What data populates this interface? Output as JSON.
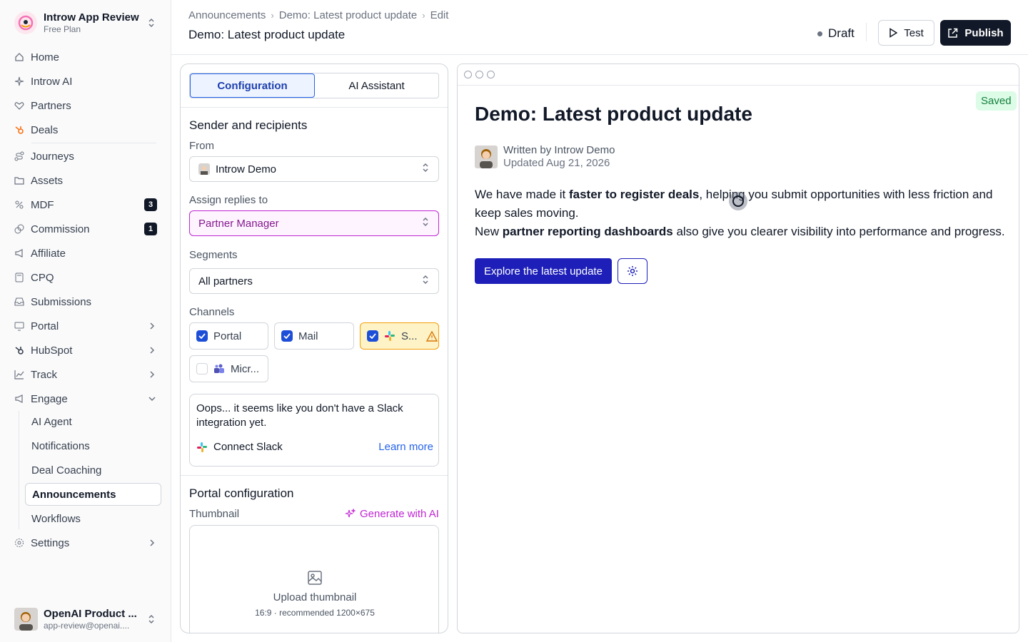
{
  "workspace": {
    "name": "Introw App Review",
    "plan": "Free Plan"
  },
  "nav": {
    "home": "Home",
    "introw_ai": "Introw AI",
    "partners": "Partners",
    "deals": "Deals",
    "journeys": "Journeys",
    "assets": "Assets",
    "mdf": "MDF",
    "mdf_count": "3",
    "commission": "Commission",
    "commission_count": "1",
    "affiliate": "Affiliate",
    "cpq": "CPQ",
    "submissions": "Submissions",
    "portal": "Portal",
    "hubspot": "HubSpot",
    "track": "Track",
    "engage": "Engage",
    "engage_items": [
      "AI Agent",
      "Notifications",
      "Deal Coaching",
      "Announcements",
      "Workflows"
    ],
    "settings": "Settings"
  },
  "user": {
    "name": "OpenAI Product ...",
    "email": "app-review@openai...."
  },
  "header": {
    "breadcrumbs": [
      "Announcements",
      "Demo: Latest product update",
      "Edit"
    ],
    "title": "Demo: Latest product update",
    "status": "Draft",
    "test_label": "Test",
    "publish_label": "Publish"
  },
  "config": {
    "tabs": [
      "Configuration",
      "AI Assistant"
    ],
    "section_title": "Sender and recipients",
    "from_label": "From",
    "from_value": "Introw Demo",
    "replies_label": "Assign replies to",
    "replies_value": "Partner Manager",
    "segments_label": "Segments",
    "segments_value": "All partners",
    "channels_label": "Channels",
    "channels": [
      {
        "label": "Portal",
        "checked": true
      },
      {
        "label": "Mail",
        "checked": true
      },
      {
        "label": "S...",
        "checked": true,
        "warning": true
      },
      {
        "label": "Micr...",
        "checked": false
      }
    ],
    "slack_warning": "Oops... it seems like you don't have a Slack integration yet.",
    "connect_slack": "Connect Slack",
    "learn_more": "Learn more",
    "portal_title": "Portal configuration",
    "thumbnail_label": "Thumbnail",
    "generate_ai": "Generate with AI",
    "upload_title": "Upload thumbnail",
    "upload_hint": "16:9 · recommended 1200×675"
  },
  "preview": {
    "saved": "Saved",
    "title": "Demo: Latest product update",
    "written_by": "Written by Introw Demo",
    "updated": "Updated Aug 21, 2026",
    "p1_a": "We have made it ",
    "p1_b": "faster to register deals",
    "p1_c": ", helping you submit opportunities with less friction and keep sales moving.",
    "p2_a": "New ",
    "p2_b": "partner reporting dashboards",
    "p2_c": " also give you clearer visibility into performance and progress.",
    "cta": "Explore the latest update"
  },
  "colors": {
    "accent": "#1d1fb8",
    "publish": "#111827",
    "magenta": "#c026d3",
    "saved": "#15803d"
  }
}
